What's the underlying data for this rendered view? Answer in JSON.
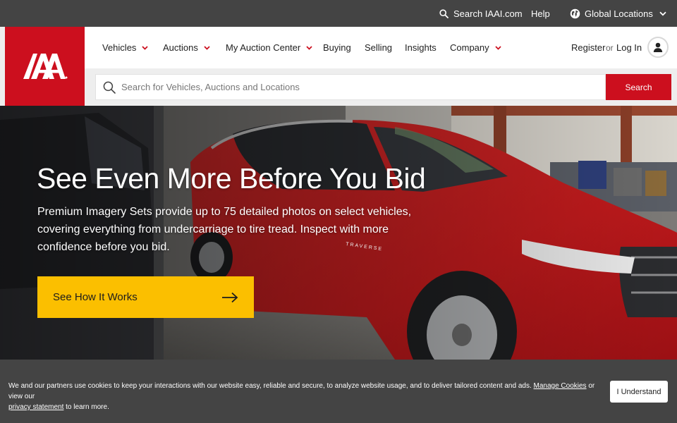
{
  "utility_bar": {
    "search_label": "Search IAAI.com",
    "help_label": "Help",
    "global_label": "Global Locations"
  },
  "logo": {
    "text": "IAA"
  },
  "nav": {
    "items": [
      {
        "label": "Vehicles",
        "has_dropdown": true
      },
      {
        "label": "Auctions",
        "has_dropdown": true
      },
      {
        "label": "My Auction Center",
        "has_dropdown": true
      },
      {
        "label": "Buying",
        "has_dropdown": false
      },
      {
        "label": "Selling",
        "has_dropdown": false
      },
      {
        "label": "Insights",
        "has_dropdown": false
      },
      {
        "label": "Company",
        "has_dropdown": true
      }
    ],
    "register_label": "Register",
    "or_label": "or",
    "login_label": "Log In"
  },
  "search": {
    "placeholder": "Search for Vehicles, Auctions and Locations",
    "value": "",
    "button_label": "Search"
  },
  "hero": {
    "title": "See Even More Before You Bid",
    "subtitle": "Premium Imagery Sets provide up to 75 detailed photos on select vehicles, covering everything from undercarriage to tire tread. Inspect with more confidence before you bid.",
    "cta_label": "See How It Works",
    "badge_text": "TRAVERSE"
  },
  "cookie": {
    "text_before": "We and our partners use cookies to keep your interactions with our website easy, reliable and secure, to analyze website usage, and to deliver tailored content and ads.",
    "manage_link": "Manage Cookies",
    "text_middle": "or view our",
    "privacy_link": "privacy statement",
    "text_after": "to learn more.",
    "button_label": "I Understand"
  },
  "colors": {
    "brand_red": "#cc0f1e",
    "cta_yellow": "#fbbf00",
    "utility_gray": "#444444"
  },
  "icons": {
    "utility_search": "search-icon",
    "global": "globe-icon",
    "dropdown": "chevron-down-icon",
    "account": "user-icon",
    "cta_arrow": "arrow-right-icon"
  }
}
